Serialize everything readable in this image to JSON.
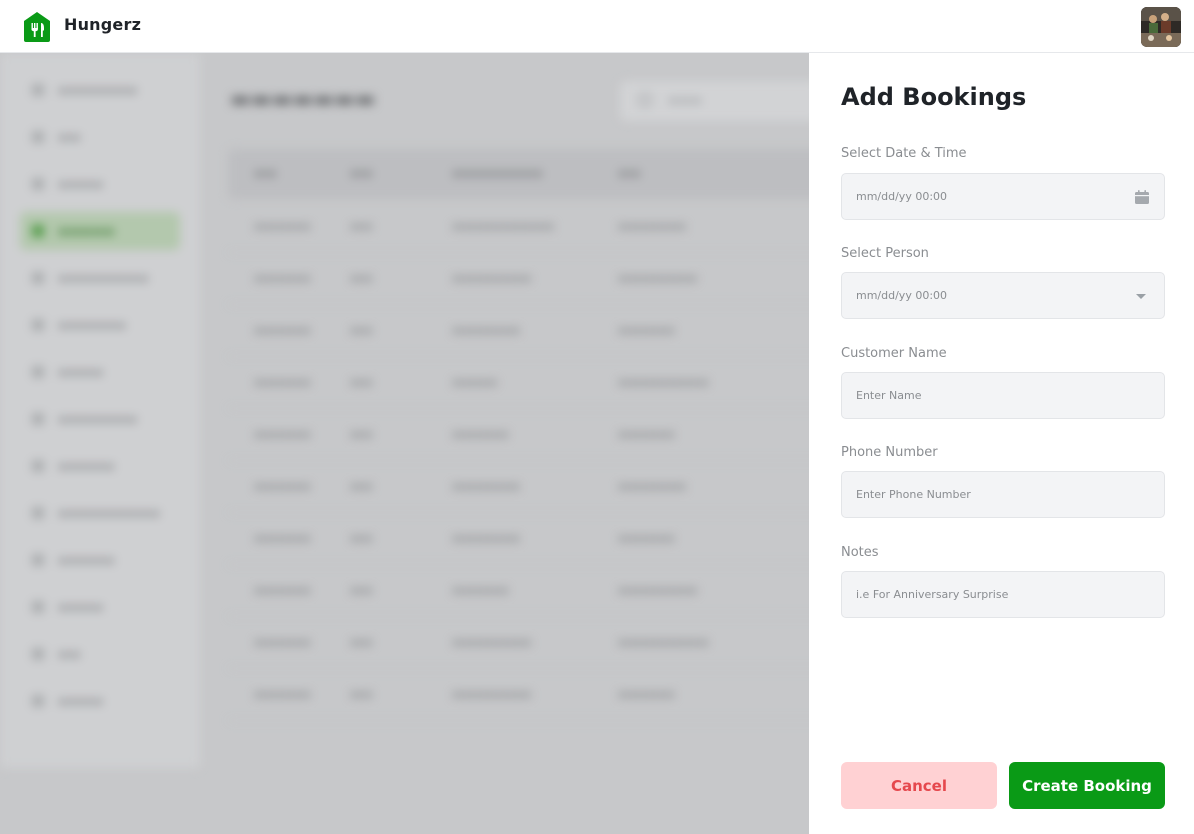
{
  "app": {
    "name": "Hungerz"
  },
  "colors": {
    "accent": "#0a9a16",
    "cancel_bg": "#ffd1d3",
    "cancel_text": "#e5484d"
  },
  "panel": {
    "title": "Add Bookings",
    "fields": [
      {
        "label": "Select Date & Time",
        "placeholder": "mm/dd/yy 00:00",
        "icon": "calendar-icon"
      },
      {
        "label": "Select Person",
        "placeholder": "mm/dd/yy 00:00",
        "icon": "chevron-down-icon"
      },
      {
        "label": "Customer Name",
        "placeholder": "Enter Name"
      },
      {
        "label": "Phone Number",
        "placeholder": "Enter Phone Number"
      },
      {
        "label": "Notes",
        "placeholder": "i.e For Anniversary Surprise"
      }
    ],
    "cancel_label": "Cancel",
    "create_label": "Create Booking"
  }
}
